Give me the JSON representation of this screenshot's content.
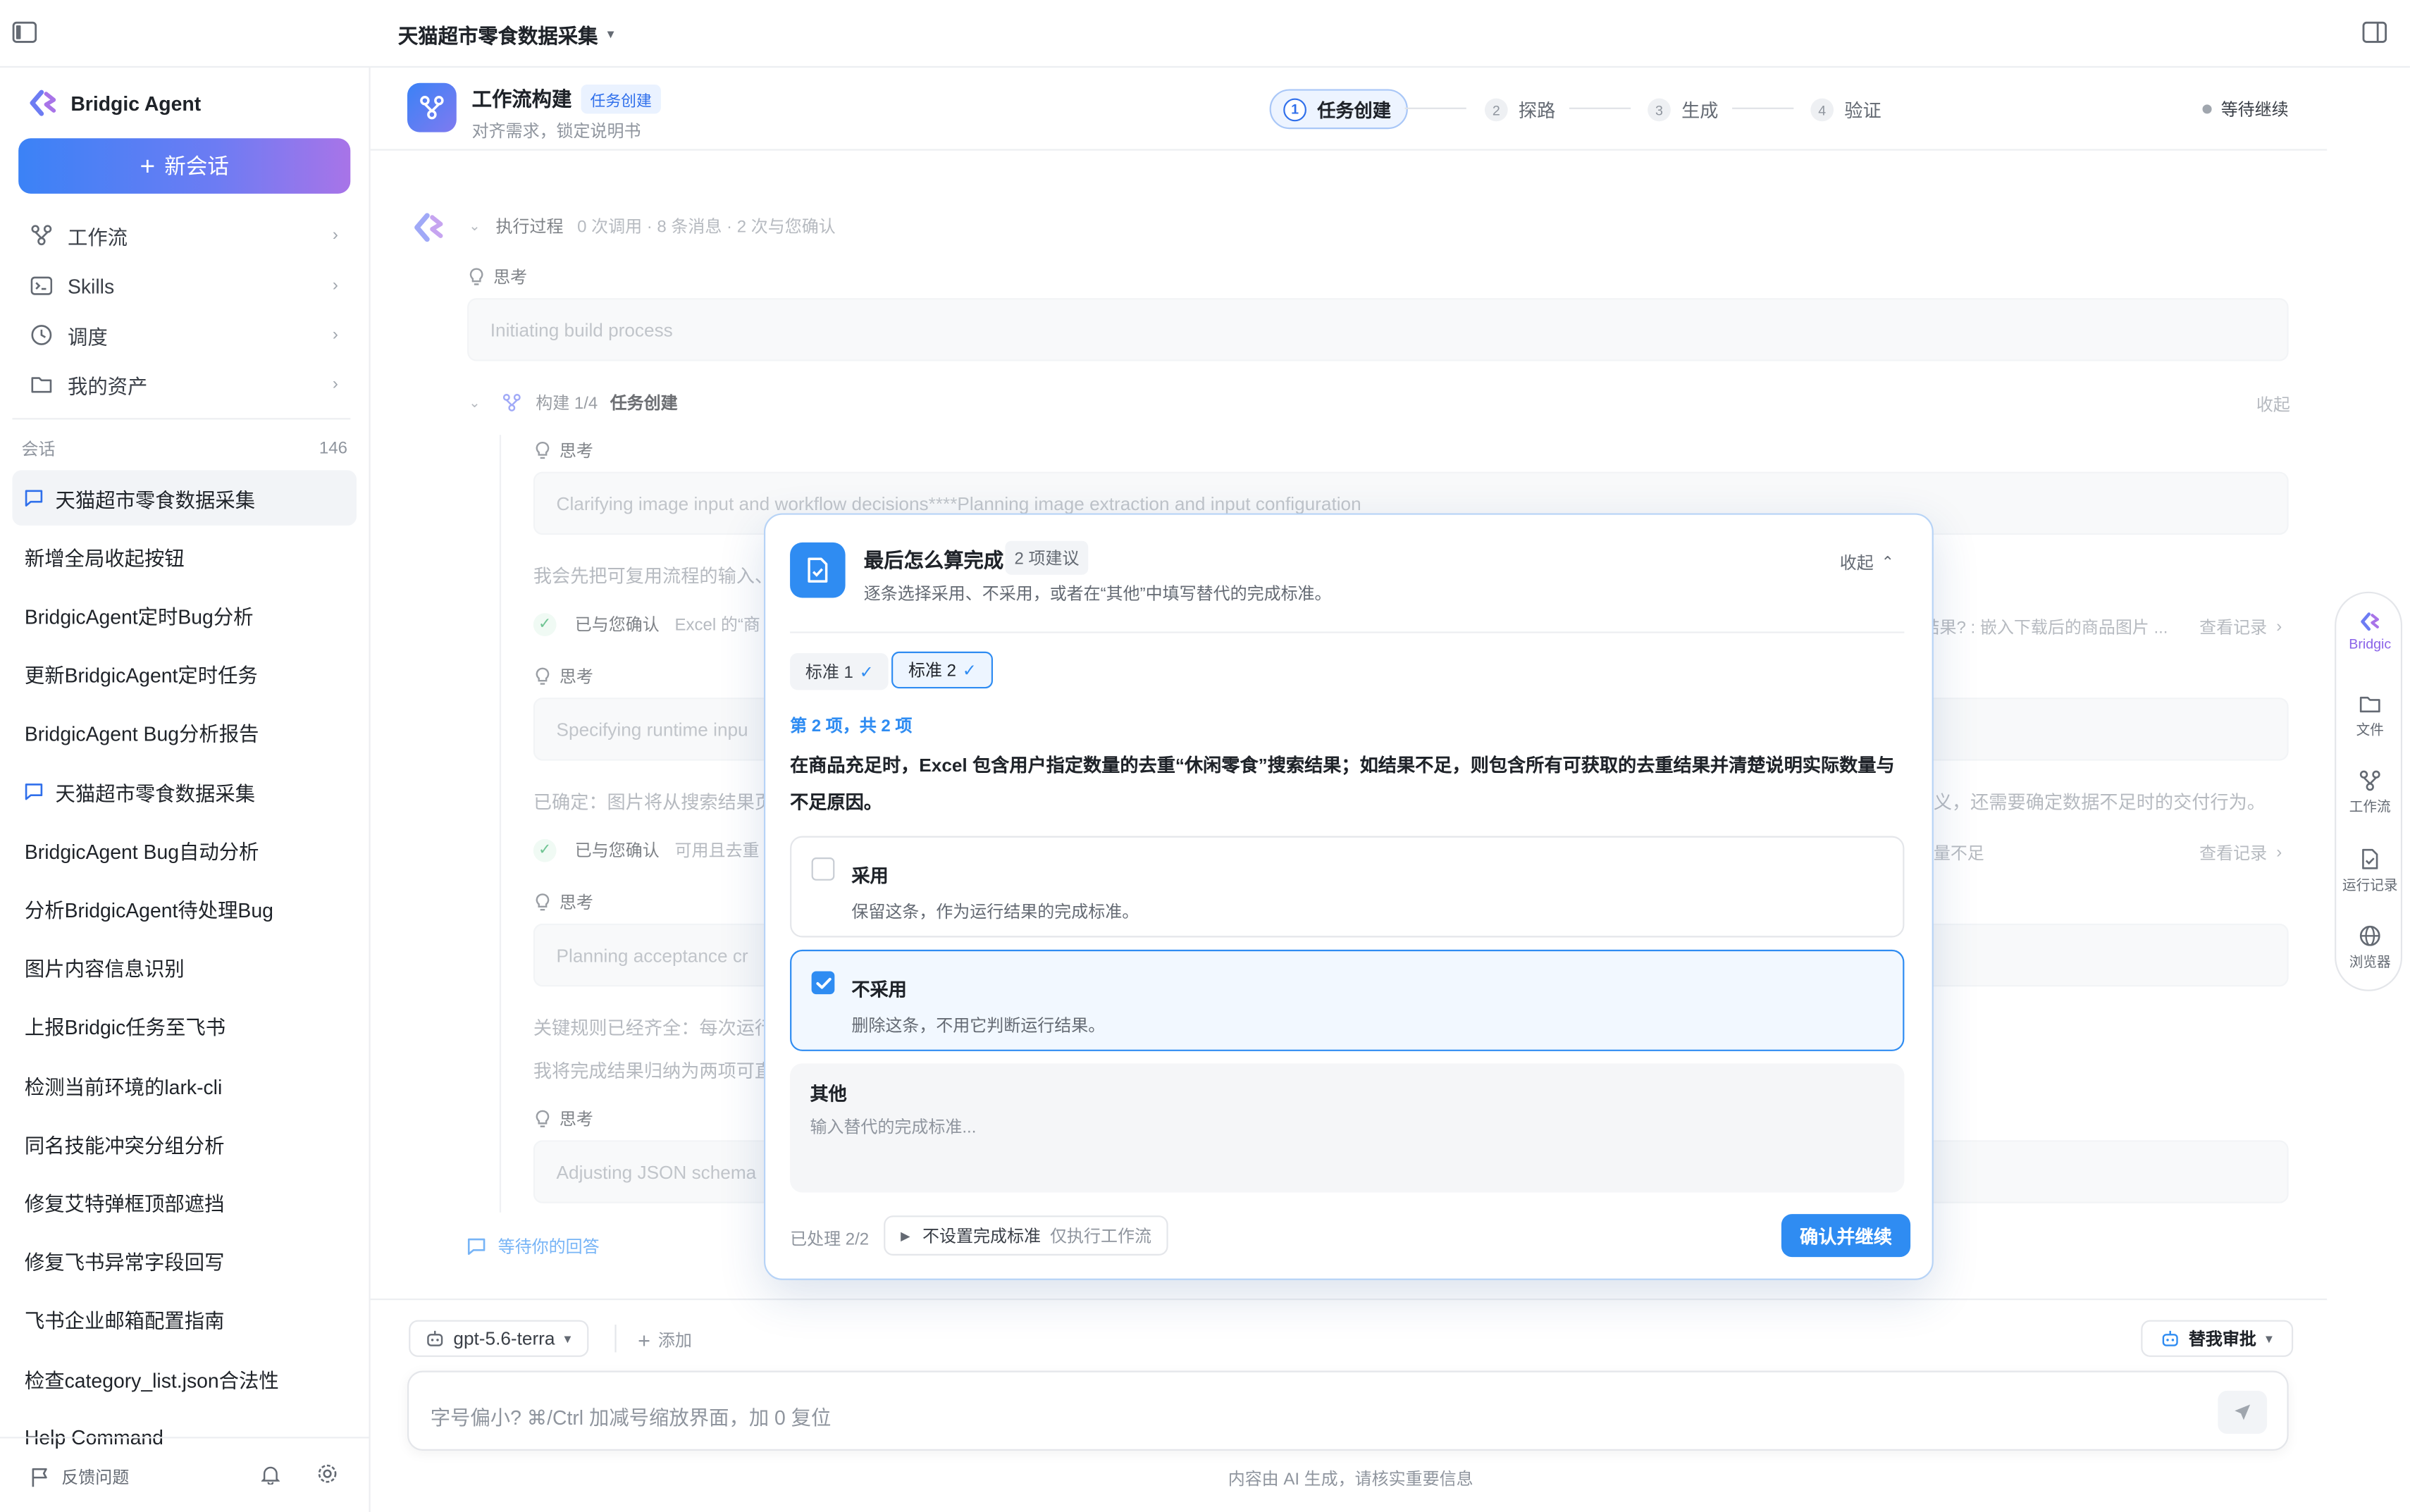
{
  "window": {
    "title": "天猫超市零食数据采集"
  },
  "sidebar": {
    "brand": "Bridgic Agent",
    "new_chat": "新会话",
    "nav": [
      {
        "label": "工作流"
      },
      {
        "label": "Skills"
      },
      {
        "label": "调度"
      },
      {
        "label": "我的资产"
      }
    ],
    "sessions_label": "会话",
    "sessions_count": "146",
    "sessions": [
      "天猫超市零食数据采集",
      "新增全局收起按钮",
      "BridgicAgent定时Bug分析",
      "更新BridgicAgent定时任务",
      "BridgicAgent Bug分析报告",
      "天猫超市零食数据采集",
      "BridgicAgent Bug自动分析",
      "分析BridgicAgent待处理Bug",
      "图片内容信息识别",
      "上报Bridgic任务至飞书",
      "检测当前环境的lark-cli",
      "同名技能冲突分组分析",
      "修复艾特弹框顶部遮挡",
      "修复飞书异常字段回写",
      "飞书企业邮箱配置指南",
      "检查category_list.json合法性",
      "Help Command"
    ],
    "feedback": "反馈问题"
  },
  "workflow": {
    "title": "工作流构建",
    "tag": "任务创建",
    "subtitle": "对齐需求，锁定说明书",
    "steps": [
      {
        "num": "1",
        "label": "任务创建"
      },
      {
        "num": "2",
        "label": "探路"
      },
      {
        "num": "3",
        "label": "生成"
      },
      {
        "num": "4",
        "label": "验证"
      }
    ],
    "status": "等待继续"
  },
  "conversation": {
    "exec_title": "执行过程",
    "exec_meta": "0 次调用 · 8 条消息 · 2 次与您确认",
    "think_label": "思考",
    "think1": "Initiating build process",
    "build_label": "构建 1/4",
    "build_title": "任务创建",
    "collapse": "收起",
    "think2": "Clarifying image input and workflow decisions****Planning image extraction and input configuration",
    "para1": "我会先把可复用流程的输入、",
    "confirmed_label": "已与您确认",
    "confirm1_detail": "Excel 的“商",
    "confirm1_right": "结果? : 嵌入下载后的商品图片 ...",
    "view_record": "查看记录",
    "think3": "Specifying runtime inpu",
    "para2": "已确定：图片将从搜索结果页",
    "para2_right": "义，还需要确定数据不足时的交付行为。",
    "confirm2_detail": "可用且去重",
    "confirm2_right": "量不足",
    "think4": "Planning acceptance cr",
    "para3": "关键规则已经齐全：每次运行",
    "para4": "我将完成结果归纳为两项可直",
    "think5": "Adjusting JSON schema",
    "waiting": "等待你的回答"
  },
  "rail": {
    "items": [
      "Bridgic",
      "文件",
      "工作流",
      "运行记录",
      "浏览器"
    ]
  },
  "composer": {
    "model": "gpt-5.6-terra",
    "add": "添加",
    "approve": "替我审批",
    "placeholder": "字号偏小? ⌘/Ctrl 加减号缩放界面，加 0 复位",
    "disclaimer": "内容由 AI 生成，请核实重要信息"
  },
  "modal": {
    "title": "最后怎么算完成",
    "count": "2 项建议",
    "subtitle": "逐条选择采用、不采用，或者在“其他”中填写替代的完成标准。",
    "collapse": "收起",
    "tabs": [
      {
        "label": "标准 1",
        "mark": "✓"
      },
      {
        "label": "标准 2",
        "mark": "✓"
      }
    ],
    "progress": "第 2 项，共 2 项",
    "question": "在商品充足时，Excel 包含用户指定数量的去重“休闲零食”搜索结果；如结果不足，则包含所有可获取的去重结果并清楚说明实际数量与不足原因。",
    "options": [
      {
        "title": "采用",
        "desc": "保留这条，作为运行结果的完成标准。",
        "checked": false
      },
      {
        "title": "不采用",
        "desc": "删除这条，不用它判断运行结果。",
        "checked": true
      }
    ],
    "other_label": "其他",
    "other_placeholder": "输入替代的完成标准...",
    "processed": "已处理 2/2",
    "no_standard": "不设置完成标准",
    "no_standard_hint": "仅执行工作流",
    "confirm": "确认并继续"
  },
  "colors": {
    "accent": "#2f8cf2",
    "brand_gradient_start": "#3b82f6",
    "brand_gradient_end": "#a874e8"
  }
}
